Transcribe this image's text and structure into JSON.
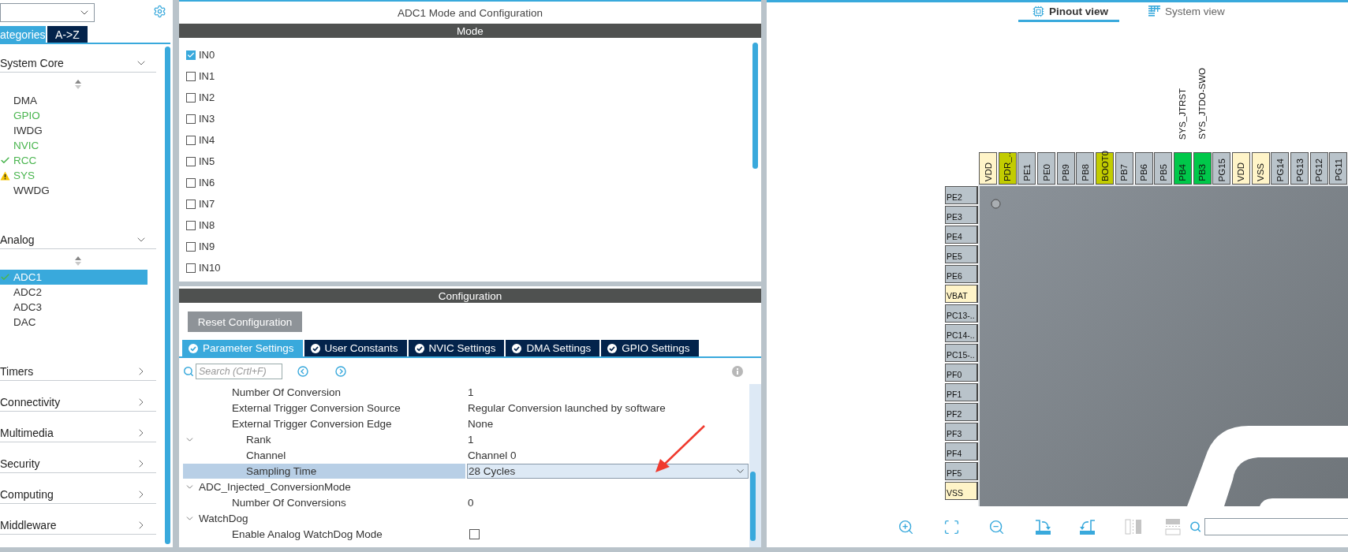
{
  "left_panel": {
    "tabs": [
      {
        "label": "ategories",
        "selected": true
      },
      {
        "label": "A->Z",
        "selected": false
      }
    ],
    "categories": [
      {
        "label": "System Core",
        "expanded": true,
        "items": [
          {
            "label": "DMA",
            "kind": "plain",
            "selected": false
          },
          {
            "label": "GPIO",
            "kind": "enabled",
            "selected": false
          },
          {
            "label": "IWDG",
            "kind": "plain",
            "selected": false
          },
          {
            "label": "NVIC",
            "kind": "enabled",
            "selected": false
          },
          {
            "label": "RCC",
            "kind": "ok",
            "selected": false
          },
          {
            "label": "SYS",
            "kind": "warning",
            "selected": false
          },
          {
            "label": "WWDG",
            "kind": "plain",
            "selected": false
          }
        ]
      },
      {
        "label": "Analog",
        "expanded": true,
        "items": [
          {
            "label": "ADC1",
            "kind": "ok",
            "selected": true
          },
          {
            "label": "ADC2",
            "kind": "plain",
            "selected": false
          },
          {
            "label": "ADC3",
            "kind": "plain",
            "selected": false
          },
          {
            "label": "DAC",
            "kind": "plain",
            "selected": false
          }
        ]
      },
      {
        "label": "Timers",
        "expanded": false
      },
      {
        "label": "Connectivity",
        "expanded": false
      },
      {
        "label": "Multimedia",
        "expanded": false
      },
      {
        "label": "Security",
        "expanded": false
      },
      {
        "label": "Computing",
        "expanded": false
      },
      {
        "label": "Middleware",
        "expanded": false
      }
    ]
  },
  "config_window": {
    "title": "ADC1 Mode and Configuration",
    "mode_header": "Mode",
    "channels": [
      {
        "label": "IN0",
        "checked": true
      },
      {
        "label": "IN1",
        "checked": false
      },
      {
        "label": "IN2",
        "checked": false
      },
      {
        "label": "IN3",
        "checked": false
      },
      {
        "label": "IN4",
        "checked": false
      },
      {
        "label": "IN5",
        "checked": false
      },
      {
        "label": "IN6",
        "checked": false
      },
      {
        "label": "IN7",
        "checked": false
      },
      {
        "label": "IN8",
        "checked": false
      },
      {
        "label": "IN9",
        "checked": false
      },
      {
        "label": "IN10",
        "checked": false
      }
    ],
    "config_header": "Configuration",
    "reset_button": "Reset Configuration",
    "tabs": [
      {
        "label": "Parameter Settings",
        "selected": true
      },
      {
        "label": "User Constants",
        "selected": false
      },
      {
        "label": "NVIC Settings",
        "selected": false
      },
      {
        "label": "DMA Settings",
        "selected": false
      },
      {
        "label": "GPIO Settings",
        "selected": false
      }
    ],
    "search": {
      "placeholder": "Search (Crtl+F)"
    },
    "parameters": [
      {
        "kind": "text",
        "label": "Number Of Conversion",
        "value": "1",
        "selected": false
      },
      {
        "kind": "text",
        "label": "External Trigger Conversion Source",
        "value": "Regular Conversion launched by software",
        "selected": false
      },
      {
        "kind": "text",
        "label": "External Trigger Conversion Edge",
        "value": "None",
        "selected": false
      },
      {
        "kind": "text",
        "label": "Rank",
        "value": "1",
        "selected": false,
        "expanded": true,
        "children": [
          {
            "kind": "text",
            "label": "Channel",
            "value": "Channel 0",
            "selected": false
          },
          {
            "kind": "select",
            "label": "Sampling Time",
            "value": "28 Cycles",
            "selected": true
          }
        ]
      },
      {
        "kind": "group",
        "label": "ADC_Injected_ConversionMode",
        "selected": false,
        "expanded": true,
        "children": [
          {
            "kind": "text",
            "label": "Number Of Conversions",
            "value": "0",
            "selected": false
          }
        ]
      },
      {
        "kind": "group",
        "label": "WatchDog",
        "selected": false,
        "expanded": true,
        "children": [
          {
            "kind": "checkbox",
            "label": "Enable Analog WatchDog Mode",
            "checked": false,
            "selected": false
          }
        ]
      }
    ]
  },
  "pinout": {
    "tabs": [
      {
        "label": "Pinout view",
        "selected": true
      },
      {
        "label": "System view",
        "selected": false
      }
    ],
    "top_pins": [
      {
        "label": "VDD",
        "color": "#fff4c8"
      },
      {
        "label": "PDR_..",
        "color": "#c2cc00"
      },
      {
        "label": "PE1",
        "color": "#b9c3ca"
      },
      {
        "label": "PE0",
        "color": "#b9c3ca"
      },
      {
        "label": "PB9",
        "color": "#b9c3ca"
      },
      {
        "label": "PB8",
        "color": "#b9c3ca"
      },
      {
        "label": "BOOT0",
        "color": "#c2cc00"
      },
      {
        "label": "PB7",
        "color": "#b9c3ca"
      },
      {
        "label": "PB6",
        "color": "#b9c3ca"
      },
      {
        "label": "PB5",
        "color": "#b9c3ca"
      },
      {
        "label": "PB4",
        "color": "#00c84a",
        "signal": "SYS_JTRST"
      },
      {
        "label": "PB3",
        "color": "#00c84a",
        "signal": "SYS_JTDO-SWO"
      },
      {
        "label": "PG15",
        "color": "#b9c3ca"
      },
      {
        "label": "VDD",
        "color": "#fff4c8"
      },
      {
        "label": "VSS",
        "color": "#fff4c8"
      },
      {
        "label": "PG14",
        "color": "#b9c3ca"
      },
      {
        "label": "PG13",
        "color": "#b9c3ca"
      },
      {
        "label": "PG12",
        "color": "#b9c3ca"
      },
      {
        "label": "PG11",
        "color": "#b9c3ca"
      }
    ],
    "left_pins": [
      {
        "label": "PE2",
        "color": "#b9c3ca"
      },
      {
        "label": "PE3",
        "color": "#b9c3ca"
      },
      {
        "label": "PE4",
        "color": "#b9c3ca"
      },
      {
        "label": "PE5",
        "color": "#b9c3ca"
      },
      {
        "label": "PE6",
        "color": "#b9c3ca"
      },
      {
        "label": "VBAT",
        "color": "#fff4c8"
      },
      {
        "label": "PC13-..",
        "color": "#b9c3ca"
      },
      {
        "label": "PC14-..",
        "color": "#b9c3ca"
      },
      {
        "label": "PC15-..",
        "color": "#b9c3ca"
      },
      {
        "label": "PF0",
        "color": "#b9c3ca"
      },
      {
        "label": "PF1",
        "color": "#b9c3ca"
      },
      {
        "label": "PF2",
        "color": "#b9c3ca"
      },
      {
        "label": "PF3",
        "color": "#b9c3ca"
      },
      {
        "label": "PF4",
        "color": "#b9c3ca"
      },
      {
        "label": "PF5",
        "color": "#b9c3ca"
      },
      {
        "label": "VSS",
        "color": "#fff4c8"
      }
    ]
  }
}
